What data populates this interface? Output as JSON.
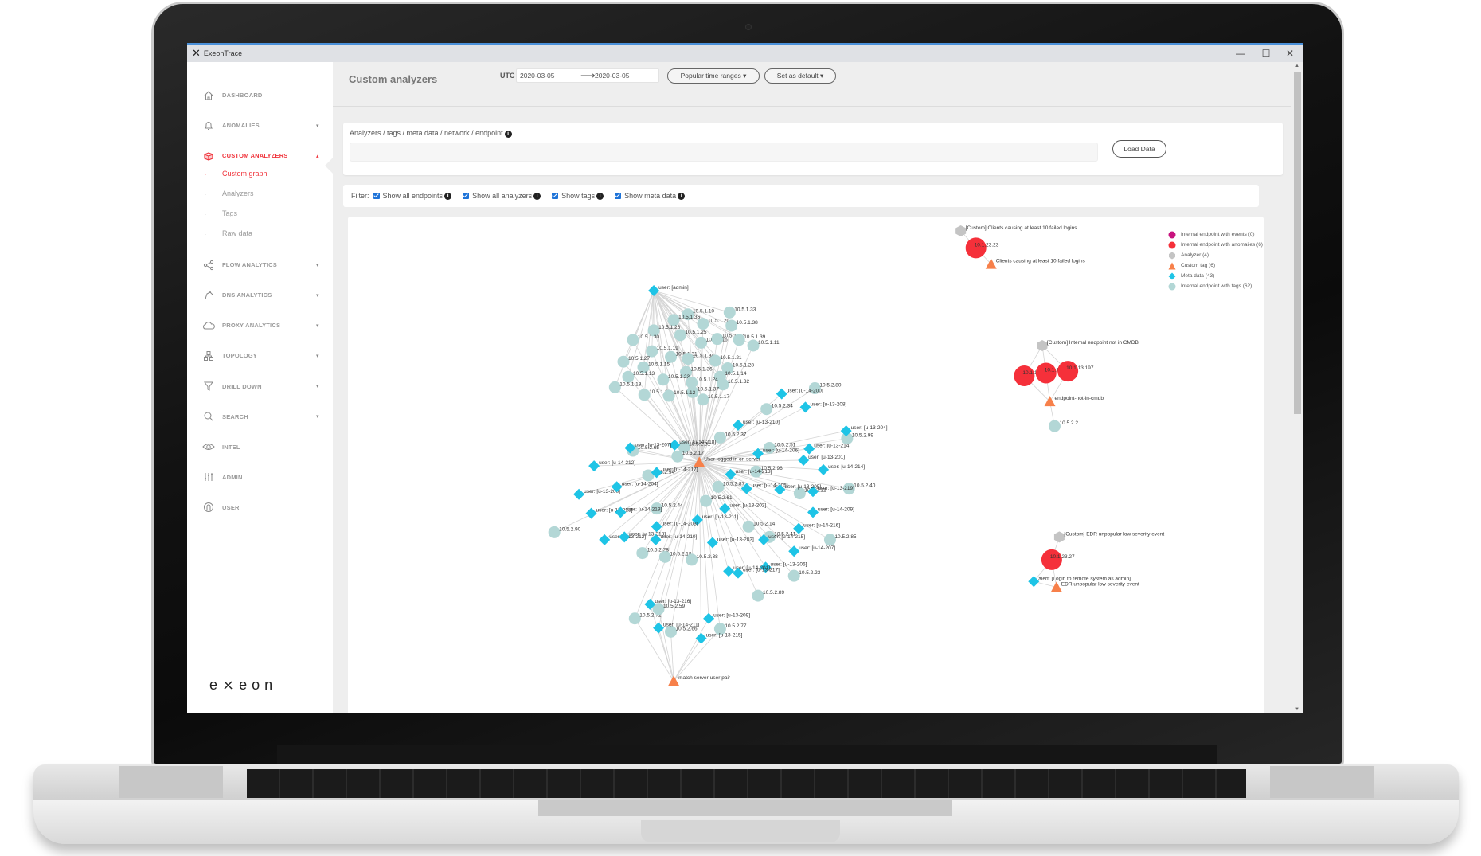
{
  "window": {
    "title": "ExeonTrace",
    "logo_glyph": "✕",
    "controls": {
      "minimize": "—",
      "maximize": "☐",
      "close": "✕"
    }
  },
  "sidebar": {
    "items": [
      {
        "label": "DASHBOARD",
        "icon": "home-icon",
        "caret": ""
      },
      {
        "label": "ANOMALIES",
        "icon": "bell-icon",
        "caret": "▾"
      },
      {
        "label": "CUSTOM ANALYZERS",
        "icon": "box-icon",
        "caret": "▴",
        "active": true
      },
      {
        "label": "FLOW ANALYTICS",
        "icon": "share-icon",
        "caret": "▾"
      },
      {
        "label": "DNS ANALYTICS",
        "icon": "dns-icon",
        "caret": "▾"
      },
      {
        "label": "PROXY ANALYTICS",
        "icon": "cloud-icon",
        "caret": "▾"
      },
      {
        "label": "TOPOLOGY",
        "icon": "topology-icon",
        "caret": "▾"
      },
      {
        "label": "DRILL DOWN",
        "icon": "filter-icon",
        "caret": "▾"
      },
      {
        "label": "SEARCH",
        "icon": "search-icon",
        "caret": "▾"
      },
      {
        "label": "INTEL",
        "icon": "eye-icon",
        "caret": ""
      },
      {
        "label": "ADMIN",
        "icon": "sliders-icon",
        "caret": ""
      },
      {
        "label": "USER",
        "icon": "user-icon",
        "caret": ""
      }
    ],
    "sub_items": [
      {
        "label": "Custom graph",
        "active": true
      },
      {
        "label": "Analyzers"
      },
      {
        "label": "Tags"
      },
      {
        "label": "Raw data"
      }
    ],
    "brand": "e⨯eon"
  },
  "header": {
    "title": "Custom analyzers",
    "timezone": "UTC",
    "date_from": "2020-03-05",
    "date_arrow": "⟶",
    "date_to": "2020-03-05",
    "popular_ranges_label": "Popular time ranges ▾",
    "set_default_label": "Set as default ▾"
  },
  "query": {
    "label": "Analyzers / tags / meta data / network / endpoint",
    "info": "i",
    "value": "",
    "load_button": "Load Data"
  },
  "filter": {
    "label": "Filter:",
    "options": [
      {
        "label": "Show all endpoints",
        "checked": true
      },
      {
        "label": "Show all analyzers",
        "checked": true
      },
      {
        "label": "Show tags",
        "checked": true
      },
      {
        "label": "Show meta data",
        "checked": true
      }
    ]
  },
  "colors": {
    "events": "#c8137e",
    "anomalies": "#f5303a",
    "analyzer": "#c4c4c4",
    "custom_tag": "#f7804a",
    "meta_data": "#1ec4e6",
    "tagged_endpoint": "#b3d7d6",
    "accent": "#f0343c"
  },
  "legend": [
    {
      "label": "Internal endpoint with events (0)",
      "type": "events"
    },
    {
      "label": "Internal endpoint with anomalies (6)",
      "type": "anomalies"
    },
    {
      "label": "Analyzer (4)",
      "type": "analyzer"
    },
    {
      "label": "Custom tag (6)",
      "type": "custom_tag"
    },
    {
      "label": "Meta data (43)",
      "type": "meta_data"
    },
    {
      "label": "Internal endpoint with tags (62)",
      "type": "tagged_endpoint"
    }
  ],
  "graph": {
    "hubs": [
      {
        "id": "admin",
        "label": "user: [admin]",
        "type": "meta_data"
      },
      {
        "id": "logged",
        "label": "User logged in on server",
        "type": "custom_tag"
      },
      {
        "id": "match",
        "label": "match server-user pair",
        "type": "custom_tag"
      }
    ],
    "admin_endpoints": [
      "10.5.1.10",
      "10.5.1.33",
      "10.5.1.35",
      "10.5.1.20",
      "10.5.1.38",
      "10.5.1.26",
      "10.5.1.25",
      "10.5.1.16",
      "10.5.1.22",
      "10.5.1.39",
      "10.5.1.30",
      "10.5.1.19",
      "10.5.1.31",
      "10.5.1.11",
      "10.5.1.34",
      "10.5.1.21",
      "10.5.1.27",
      "10.5.1.15",
      "10.5.1.36",
      "10.5.1.28",
      "10.5.1.14",
      "10.5.1.13",
      "10.5.1.23",
      "10.5.1.24",
      "10.5.1.32",
      "10.5.1.18",
      "10.5.1.37",
      "10.5.1.29",
      "10.5.1.12",
      "10.5.1.17"
    ],
    "server_endpoints": [
      "10.5.2.80",
      "10.5.2.34",
      "10.5.2.37",
      "10.5.2.99",
      "10.5.2.31",
      "10.5.2.65",
      "10.5.2.17",
      "10.5.2.51",
      "10.5.2.94",
      "10.5.2.96",
      "10.5.2.40",
      "10.5.2.87",
      "10.5.2.22",
      "10.5.2.61",
      "10.5.2.44",
      "10.5.2.90",
      "10.5.2.14",
      "10.5.2.41",
      "10.5.2.85",
      "10.5.2.28",
      "10.5.2.18",
      "10.5.2.38",
      "10.5.2.23",
      "10.5.2.89",
      "10.5.2.72",
      "10.5.2.59",
      "10.5.2.66",
      "10.5.2.77"
    ],
    "server_users": [
      "user: [u-14-200]",
      "user: [u-13-208]",
      "user: [u-13-210]",
      "user: [u-13-204]",
      "user: [u-14-218]",
      "user: [u-13-207]",
      "user: [u-14-206]",
      "user: [u-13-214]",
      "user: [u-13-201]",
      "user: [u-14-212]",
      "user: [u-14-217]",
      "user: [u-14-214]",
      "user: [u-14-213]",
      "user: [u-13-200]",
      "user: [u-14-204]",
      "user: [u-14-205]",
      "user: [u-13-219]",
      "user: [u-13-213]",
      "user: [u-14-219]",
      "user: [u-13-202]",
      "user: [u-13-205]",
      "user: [u-14-209]",
      "user: [u-13-211]",
      "user: [u-14-203]",
      "user: [u-14-216]",
      "user: [u-13-212]",
      "user: [u-13-218]",
      "user: [u-14-210]",
      "user: [u-13-203]",
      "user: [u-14-215]",
      "user: [u-14-207]",
      "user: [u-13-206]",
      "user: [u-14-201]",
      "user: [u-13-217]"
    ],
    "match_users": [
      "user: [u-13-216]",
      "user: [u-13-209]",
      "user: [u-14-211]",
      "user: [u-13-215]"
    ],
    "clusters": [
      {
        "analyzer": "[Custom] Clients causing at least 10 failed logins",
        "endpoints": [
          "10.1.23.23"
        ],
        "tag": "Clients causing at least 10 failed logins"
      },
      {
        "analyzer": "[Custom] Internal endpoint not in CMDB",
        "endpoints": [
          "10.1.13.1",
          "10.1.13.195",
          "10.1.13.197"
        ],
        "tag": "endpoint-not-in-cmdb",
        "extra": "10.5.2.2"
      },
      {
        "analyzer": "[Custom] EDR unpopular low severity event",
        "endpoints": [
          "10.1.23.27"
        ],
        "meta": "alert: [Login to remote system as admin]",
        "tag": "EDR unpopular low severity event"
      }
    ]
  }
}
